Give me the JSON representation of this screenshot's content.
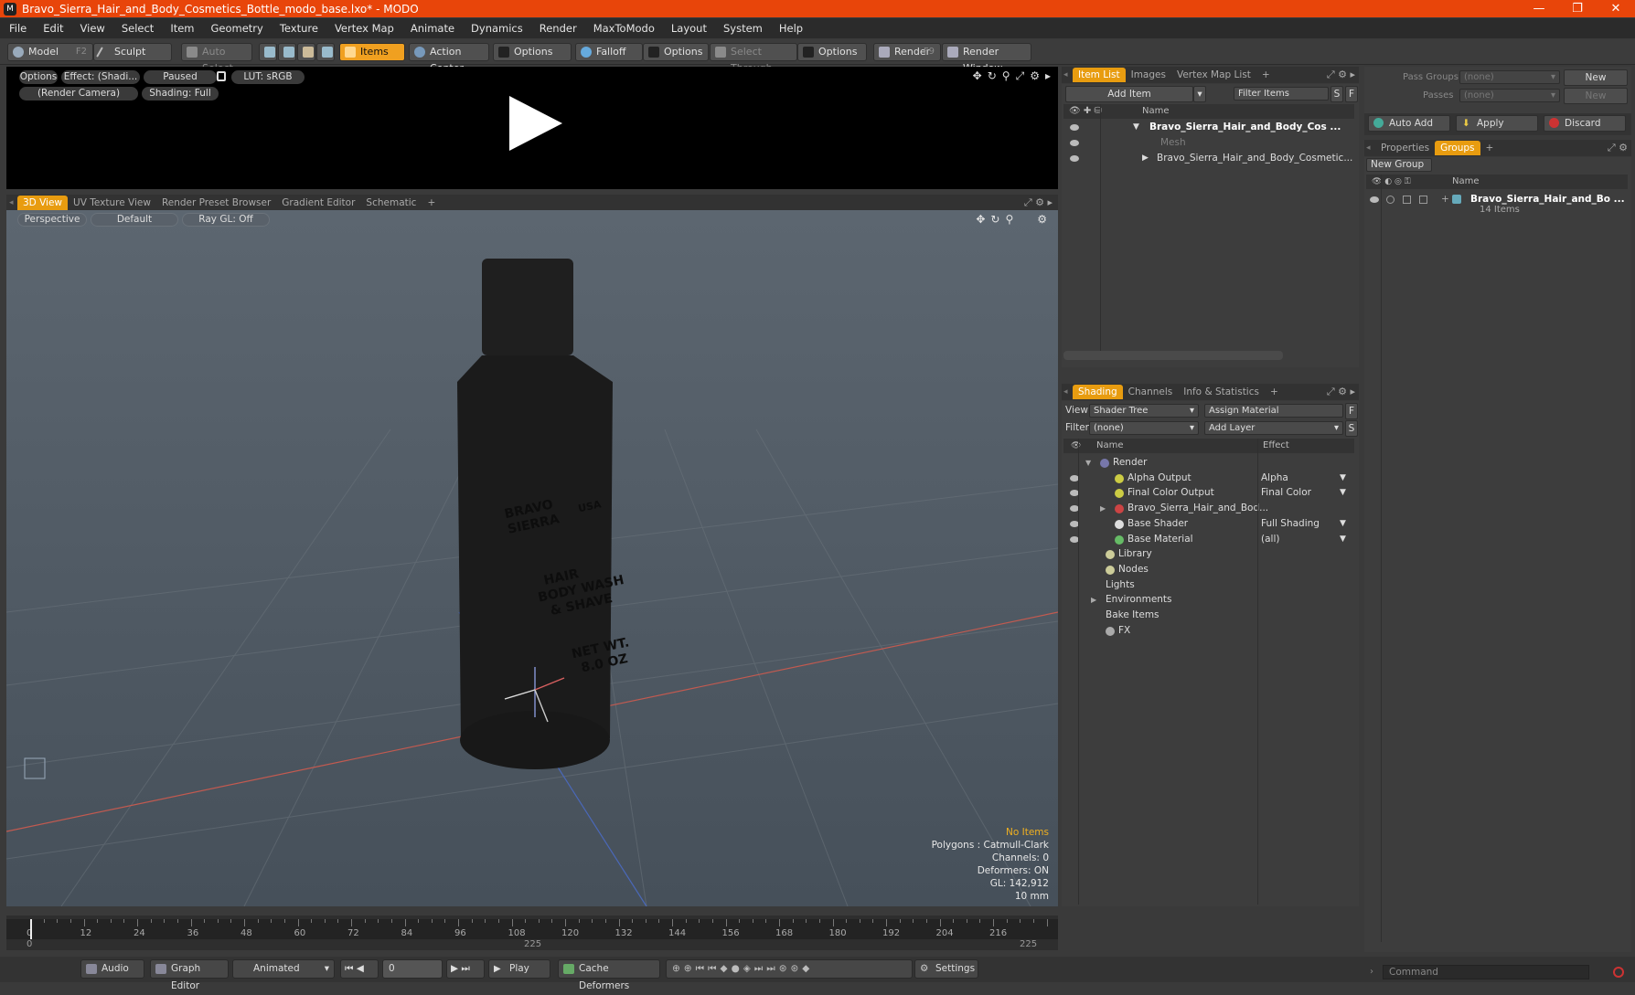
{
  "window": {
    "title": "Bravo_Sierra_Hair_and_Body_Cosmetics_Bottle_modo_base.lxo* - MODO",
    "minimize": "—",
    "restore": "❐",
    "close": "✕"
  },
  "menu": [
    "File",
    "Edit",
    "View",
    "Select",
    "Item",
    "Geometry",
    "Texture",
    "Vertex Map",
    "Animate",
    "Dynamics",
    "Render",
    "MaxToModo",
    "Layout",
    "System",
    "Help"
  ],
  "toolbar": {
    "model": "Model",
    "model_key": "F2",
    "sculpt": "Sculpt",
    "auto_select": "Auto Select",
    "items": "Items",
    "action_center": "Action Center",
    "options1": "Options",
    "falloff": "Falloff",
    "options2": "Options",
    "select_through": "Select Through",
    "options3": "Options",
    "render": "Render",
    "render_key": "F9",
    "render_window": "Render Window"
  },
  "preview": {
    "options": "Options",
    "effect": "Effect: (Shadi...",
    "paused": "Paused",
    "lut": "LUT: sRGB",
    "camera": "(Render Camera)",
    "shading": "Shading: Full"
  },
  "viewtabs": [
    "3D View",
    "UV Texture View",
    "Render Preset Browser",
    "Gradient Editor",
    "Schematic"
  ],
  "viewport": {
    "perspective": "Perspective",
    "default": "Default",
    "raygl": "Ray GL: Off",
    "bottle_text": [
      "BRAVO",
      "SIERRA",
      "USA",
      "HAIR",
      "BODY WASH",
      "& SHAVE",
      "NET WT.",
      "8.0 OZ"
    ]
  },
  "stats": {
    "items": "No Items",
    "polygons": "Polygons : Catmull-Clark",
    "channels": "Channels: 0",
    "deformers": "Deformers: ON",
    "gl": "GL: 142,912",
    "scale": "10 mm"
  },
  "timeline": {
    "ticks": [
      "0",
      "12",
      "24",
      "36",
      "48",
      "60",
      "72",
      "84",
      "96",
      "108",
      "120",
      "132",
      "144",
      "156",
      "168",
      "180",
      "192",
      "204",
      "216"
    ],
    "start": "0",
    "mid": "225",
    "end": "225"
  },
  "bottom": {
    "audio": "Audio",
    "graph_editor": "Graph Editor",
    "animated": "Animated",
    "frame": "0",
    "play": "Play",
    "cache_deformers": "Cache Deformers",
    "settings": "Settings",
    "command": "Command"
  },
  "itemlist": {
    "tabs": [
      "Item List",
      "Images",
      "Vertex Map List"
    ],
    "add_item": "Add Item",
    "filter_items": "Filter Items",
    "s": "S",
    "f": "F",
    "col_name": "Name",
    "rows": [
      "Bravo_Sierra_Hair_and_Body_Cos ...",
      "Mesh",
      "Bravo_Sierra_Hair_and_Body_Cosmetic..."
    ]
  },
  "shading": {
    "tabs": [
      "Shading",
      "Channels",
      "Info & Statistics"
    ],
    "view_label": "View",
    "view_value": "Shader Tree",
    "assign_material": "Assign Material",
    "f": "F",
    "filter_label": "Filter",
    "filter_value": "(none)",
    "add_layer": "Add Layer",
    "s": "S",
    "col_name": "Name",
    "col_effect": "Effect",
    "rows": [
      {
        "name": "Render",
        "effect": ""
      },
      {
        "name": "Alpha Output",
        "effect": "Alpha"
      },
      {
        "name": "Final Color Output",
        "effect": "Final Color"
      },
      {
        "name": "Bravo_Sierra_Hair_and_Bod...",
        "effect": ""
      },
      {
        "name": "Base Shader",
        "effect": "Full Shading"
      },
      {
        "name": "Base Material",
        "effect": "(all)"
      },
      {
        "name": "Library",
        "effect": ""
      },
      {
        "name": "Nodes",
        "effect": ""
      },
      {
        "name": "Lights",
        "effect": ""
      },
      {
        "name": "Environments",
        "effect": ""
      },
      {
        "name": "Bake Items",
        "effect": ""
      },
      {
        "name": "FX",
        "effect": ""
      }
    ]
  },
  "passes": {
    "pass_groups": "Pass Groups",
    "pass_groups_value": "(none)",
    "new1": "New",
    "passes": "Passes",
    "passes_value": "(none)",
    "new2": "New",
    "auto_add": "Auto Add",
    "apply": "Apply",
    "discard": "Discard"
  },
  "groups": {
    "tabs": [
      "Properties",
      "Groups"
    ],
    "new_group": "New Group",
    "col_name": "Name",
    "group_name": "Bravo_Sierra_Hair_and_Bo ...",
    "group_count": "14 Items"
  }
}
